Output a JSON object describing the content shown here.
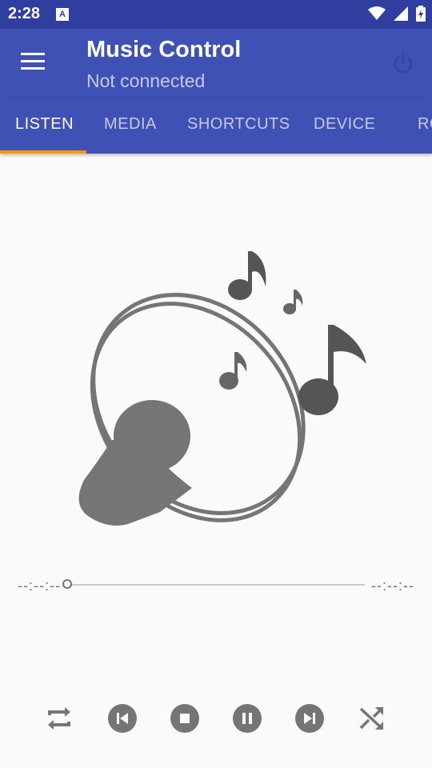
{
  "status_bar": {
    "time": "2:28",
    "app_badge": "A",
    "icons": [
      "wifi-icon",
      "signal-icon",
      "battery-charging-icon"
    ]
  },
  "app_bar": {
    "title": "Music Control",
    "subtitle": "Not connected",
    "menu_icon": "hamburger-menu-icon",
    "power_icon": "power-icon"
  },
  "tabs": [
    {
      "label": "LISTEN",
      "active": true
    },
    {
      "label": "MEDIA",
      "active": false
    },
    {
      "label": "SHORTCUTS",
      "active": false
    },
    {
      "label": "DEVICE",
      "active": false
    },
    {
      "label": "RO",
      "active": false
    }
  ],
  "player": {
    "time_elapsed": "--:--:--",
    "time_total": "--:--:--",
    "progress": 0
  },
  "controls": [
    {
      "name": "repeat",
      "icon": "repeat-icon"
    },
    {
      "name": "previous",
      "icon": "skip-previous-icon"
    },
    {
      "name": "stop",
      "icon": "stop-icon"
    },
    {
      "name": "pause",
      "icon": "pause-icon"
    },
    {
      "name": "next",
      "icon": "skip-next-icon"
    },
    {
      "name": "shuffle",
      "icon": "shuffle-icon"
    }
  ],
  "colors": {
    "primary": "#3f51b5",
    "primary_dark": "#303f9f",
    "accent": "#ff9800",
    "icon_gray": "#757575"
  }
}
